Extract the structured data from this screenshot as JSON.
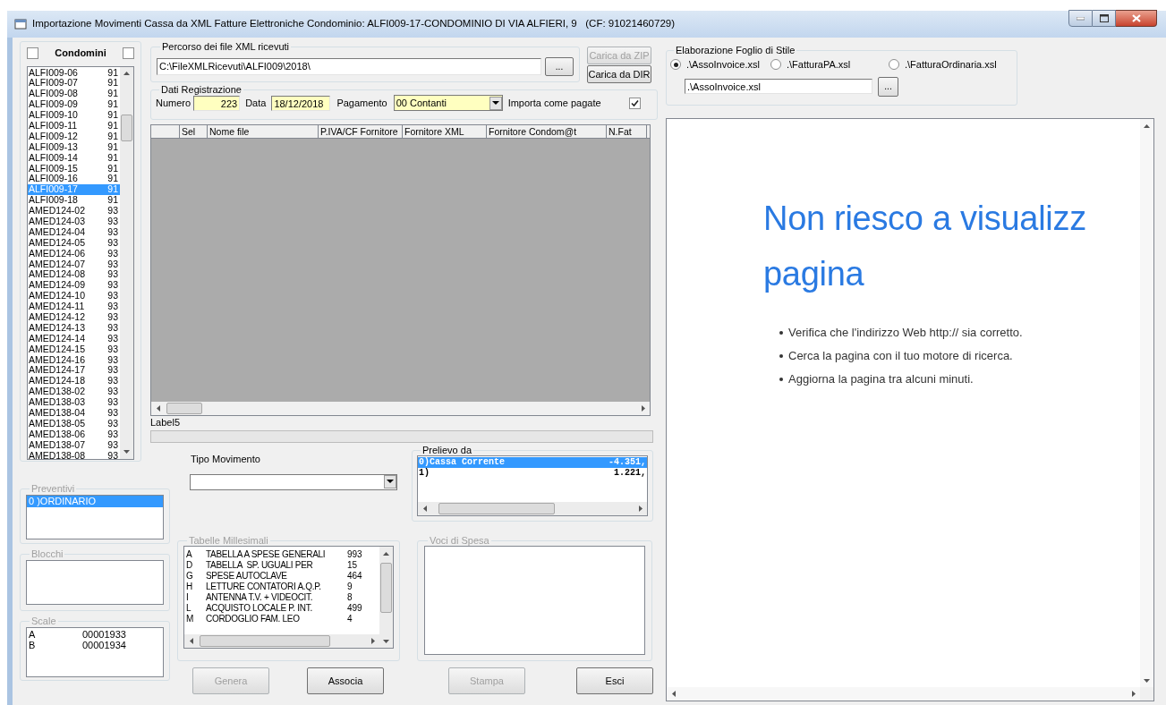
{
  "window": {
    "title": "Importazione Movimenti Cassa da XML Fatture Elettroniche Condominio: ALFI009-17-CONDOMINIO DI VIA ALFIERI, 9   (CF: 91021460729)"
  },
  "condomini": {
    "label": "Condomini",
    "check_left": false,
    "check_right": false,
    "items": [
      {
        "code": "ALFI009-06",
        "num": "91",
        "selected": false
      },
      {
        "code": "ALFI009-07",
        "num": "91",
        "selected": false
      },
      {
        "code": "ALFI009-08",
        "num": "91",
        "selected": false
      },
      {
        "code": "ALFI009-09",
        "num": "91",
        "selected": false
      },
      {
        "code": "ALFI009-10",
        "num": "91",
        "selected": false
      },
      {
        "code": "ALFI009-11",
        "num": "91",
        "selected": false
      },
      {
        "code": "ALFI009-12",
        "num": "91",
        "selected": false
      },
      {
        "code": "ALFI009-13",
        "num": "91",
        "selected": false
      },
      {
        "code": "ALFI009-14",
        "num": "91",
        "selected": false
      },
      {
        "code": "ALFI009-15",
        "num": "91",
        "selected": false
      },
      {
        "code": "ALFI009-16",
        "num": "91",
        "selected": false
      },
      {
        "code": "ALFI009-17",
        "num": "91",
        "selected": true
      },
      {
        "code": "ALFI009-18",
        "num": "91",
        "selected": false
      },
      {
        "code": "AMED124-02",
        "num": "93",
        "selected": false
      },
      {
        "code": "AMED124-03",
        "num": "93",
        "selected": false
      },
      {
        "code": "AMED124-04",
        "num": "93",
        "selected": false
      },
      {
        "code": "AMED124-05",
        "num": "93",
        "selected": false
      },
      {
        "code": "AMED124-06",
        "num": "93",
        "selected": false
      },
      {
        "code": "AMED124-07",
        "num": "93",
        "selected": false
      },
      {
        "code": "AMED124-08",
        "num": "93",
        "selected": false
      },
      {
        "code": "AMED124-09",
        "num": "93",
        "selected": false
      },
      {
        "code": "AMED124-10",
        "num": "93",
        "selected": false
      },
      {
        "code": "AMED124-11",
        "num": "93",
        "selected": false
      },
      {
        "code": "AMED124-12",
        "num": "93",
        "selected": false
      },
      {
        "code": "AMED124-13",
        "num": "93",
        "selected": false
      },
      {
        "code": "AMED124-14",
        "num": "93",
        "selected": false
      },
      {
        "code": "AMED124-15",
        "num": "93",
        "selected": false
      },
      {
        "code": "AMED124-16",
        "num": "93",
        "selected": false
      },
      {
        "code": "AMED124-17",
        "num": "93",
        "selected": false
      },
      {
        "code": "AMED124-18",
        "num": "93",
        "selected": false
      },
      {
        "code": "AMED138-02",
        "num": "93",
        "selected": false
      },
      {
        "code": "AMED138-03",
        "num": "93",
        "selected": false
      },
      {
        "code": "AMED138-04",
        "num": "93",
        "selected": false
      },
      {
        "code": "AMED138-05",
        "num": "93",
        "selected": false
      },
      {
        "code": "AMED138-06",
        "num": "93",
        "selected": false
      },
      {
        "code": "AMED138-07",
        "num": "93",
        "selected": false
      },
      {
        "code": "AMED138-08",
        "num": "93",
        "selected": false
      }
    ]
  },
  "percorso": {
    "label": "Percorso dei file XML ricevuti",
    "value": "C:\\FileXMLRicevuti\\ALFI009\\2018\\",
    "browse": "..."
  },
  "load_buttons": [
    {
      "label": "Carica da ZIP",
      "disabled": true
    },
    {
      "label": "Carica da DIR",
      "disabled": false
    }
  ],
  "dati_registrazione": {
    "label": "Dati Registrazione",
    "numero_label": "Numero",
    "numero": "223",
    "data_label": "Data",
    "data": "18/12/2018",
    "pagamento_label": "Pagamento",
    "pagamento": "00 Contanti",
    "importa_label": "Importa come pagate",
    "importa_checked": true
  },
  "table": {
    "columns": [
      "Sel",
      "Nome file",
      "P.IVA/CF Fornitore",
      "Fornitore XML",
      "Fornitore Condom@t",
      "N.Fat"
    ]
  },
  "status_label": "Label5",
  "progress": {
    "level": 0
  },
  "tipo_movimento": {
    "label": "Tipo Movimento"
  },
  "prelievo": {
    "label": "Prelievo da",
    "disabled": false,
    "items": [
      {
        "name": "0)Cassa Corrente",
        "amount": "-4.351,",
        "selected": true
      },
      {
        "name": "1)",
        "amount": "1.221,",
        "selected": false
      }
    ]
  },
  "preventivi": {
    "label": "Preventivi",
    "disabled": true,
    "items": [
      {
        "text": "0 )ORDINARIO",
        "selected": true
      }
    ]
  },
  "blocchi": {
    "label": "Blocchi",
    "disabled": true
  },
  "scale": {
    "label": "Scale",
    "disabled": true,
    "rows": [
      {
        "code": "A",
        "value": "00001933"
      },
      {
        "code": "B",
        "value": "00001934"
      }
    ]
  },
  "tabelle_millesimali": {
    "label": "Tabelle Millesimali",
    "disabled": true,
    "rows": [
      {
        "code": "A",
        "name": "TABELLA A SPESE GENERALI",
        "value": "993"
      },
      {
        "code": "D",
        "name": "TABELLA  SP. UGUALI PER",
        "value": "15"
      },
      {
        "code": "G",
        "name": "SPESE AUTOCLAVE",
        "value": "464"
      },
      {
        "code": "H",
        "name": "LETTURE CONTATORI A.Q.P.",
        "value": "9"
      },
      {
        "code": "I",
        "name": "ANTENNA T.V. + VIDEOCIT.",
        "value": "8"
      },
      {
        "code": "L",
        "name": "ACQUISTO LOCALE P. INT.",
        "value": "499"
      },
      {
        "code": "M",
        "name": "CORDOGLIO FAM. LEO",
        "value": "4"
      }
    ]
  },
  "voci_di_spesa": {
    "label": "Voci di Spesa",
    "disabled": true
  },
  "buttons": [
    {
      "label": "Genera",
      "disabled": true
    },
    {
      "label": "Associa",
      "disabled": false
    },
    {
      "label": "Stampa",
      "disabled": true
    },
    {
      "label": "Esci",
      "disabled": false
    }
  ],
  "foglio_di_stile": {
    "label": "Elaborazione Foglio di Stile",
    "options": [
      {
        "label": ".\\AssoInvoice.xsl",
        "selected": true
      },
      {
        "label": ".\\FatturaPA.xsl",
        "selected": false
      },
      {
        "label": ".\\FatturaOrdinaria.xsl",
        "selected": false
      }
    ],
    "path": ".\\AssoInvoice.xsl",
    "browse": "..."
  },
  "browser": {
    "heading_lines": [
      "Non riesco a visualizz",
      "pagina"
    ],
    "bullets": [
      "Verifica che l'indirizzo Web http:// sia corretto.",
      "Cerca la pagina con il tuo motore di ricerca.",
      "Aggiorna la pagina tra alcuni minuti."
    ]
  }
}
